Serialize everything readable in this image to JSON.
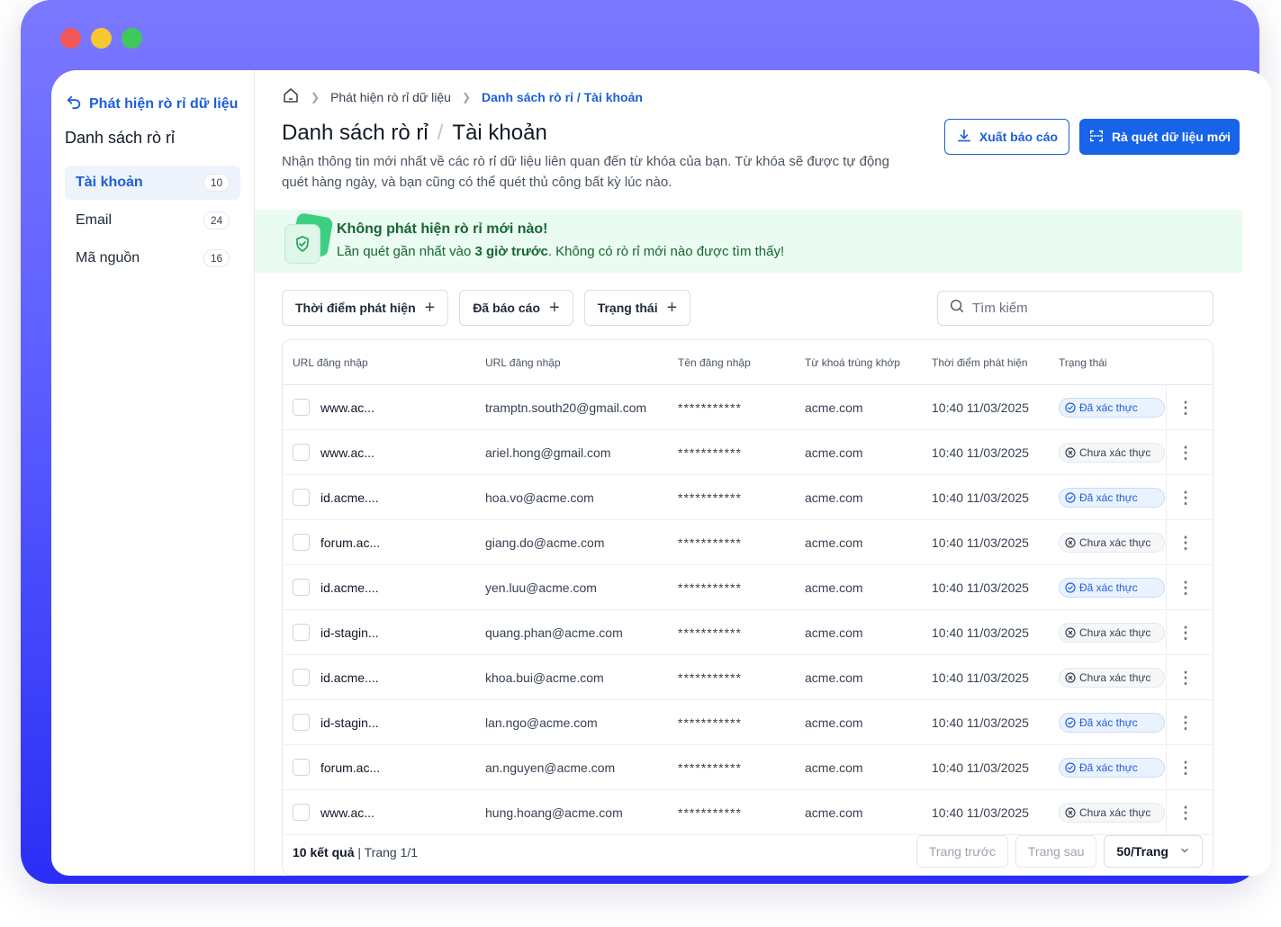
{
  "window_controls": {
    "colors": [
      "#f25757",
      "#f7c72f",
      "#3fc95a"
    ]
  },
  "sidebar": {
    "back_label": "Phát hiện rò rỉ dữ liệu",
    "title": "Danh sách rò rỉ",
    "items": [
      {
        "label": "Tài khoản",
        "count": "10",
        "active": true
      },
      {
        "label": "Email",
        "count": "24",
        "active": false
      },
      {
        "label": "Mã nguồn",
        "count": "16",
        "active": false
      }
    ]
  },
  "breadcrumb": {
    "items": [
      "Phát hiện rò rỉ dữ liệu",
      "Danh sách rò rỉ / Tài khoản"
    ]
  },
  "header": {
    "title_part1": "Danh sách rò rỉ",
    "title_sep": "/",
    "title_part2": "Tài khoản",
    "description": "Nhận thông tin mới nhất về các rò rỉ dữ liệu liên quan đến từ khóa của bạn. Từ khóa sẽ được tự động quét hàng ngày, và bạn cũng có thể quét thủ công bất kỳ lúc nào.",
    "export_label": "Xuất báo cáo",
    "scan_label": "Rà quét dữ liệu mới"
  },
  "alert": {
    "title": "Không phát hiện rò rỉ mới nào!",
    "text_before": "Lần quét gần nhất vào ",
    "text_bold": "3 giờ trước",
    "text_after": ". Không có rò rỉ mới nào được tìm thấy!"
  },
  "filters": [
    "Thời điểm phát hiện",
    "Đã báo cáo",
    "Trạng thái"
  ],
  "search": {
    "placeholder": "Tìm kiếm",
    "value": ""
  },
  "table": {
    "columns": [
      "URL đăng nhập",
      "URL đăng nhập",
      "Tên đăng nhập",
      "Từ khoá trùng khớp",
      "Thời điểm phát hiện",
      "Trạng thái"
    ],
    "rows": [
      {
        "url": "www.ac...",
        "login": "tramptn.south20@gmail.com",
        "username": "***********",
        "keyword": "acme.com",
        "time": "10:40 11/03/2025",
        "status": "Đã xác thực",
        "verified": true
      },
      {
        "url": "www.ac...",
        "login": "ariel.hong@gmail.com",
        "username": "***********",
        "keyword": "acme.com",
        "time": "10:40 11/03/2025",
        "status": "Chưa xác thực",
        "verified": false
      },
      {
        "url": "id.acme....",
        "login": "hoa.vo@acme.com",
        "username": "***********",
        "keyword": "acme.com",
        "time": "10:40 11/03/2025",
        "status": "Đã xác thực",
        "verified": true
      },
      {
        "url": "forum.ac...",
        "login": "giang.do@acme.com",
        "username": "***********",
        "keyword": "acme.com",
        "time": "10:40 11/03/2025",
        "status": "Chưa xác thực",
        "verified": false
      },
      {
        "url": "id.acme....",
        "login": "yen.luu@acme.com",
        "username": "***********",
        "keyword": "acme.com",
        "time": "10:40 11/03/2025",
        "status": "Đã xác thực",
        "verified": true
      },
      {
        "url": "id-stagin...",
        "login": "quang.phan@acme.com",
        "username": "***********",
        "keyword": "acme.com",
        "time": "10:40 11/03/2025",
        "status": "Chưa xác thực",
        "verified": false
      },
      {
        "url": "id.acme....",
        "login": "khoa.bui@acme.com",
        "username": "***********",
        "keyword": "acme.com",
        "time": "10:40 11/03/2025",
        "status": "Chưa xác thực",
        "verified": false
      },
      {
        "url": "id-stagin...",
        "login": "lan.ngo@acme.com",
        "username": "***********",
        "keyword": "acme.com",
        "time": "10:40 11/03/2025",
        "status": "Đã xác thực",
        "verified": true
      },
      {
        "url": "forum.ac...",
        "login": "an.nguyen@acme.com",
        "username": "***********",
        "keyword": "acme.com",
        "time": "10:40 11/03/2025",
        "status": "Đã xác thực",
        "verified": true
      },
      {
        "url": "www.ac...",
        "login": "hung.hoang@acme.com",
        "username": "***********",
        "keyword": "acme.com",
        "time": "10:40 11/03/2025",
        "status": "Chưa xác thực",
        "verified": false
      }
    ]
  },
  "footer": {
    "results_bold": "10 kết quả",
    "page_info": " | Trang 1/1",
    "prev_label": "Trang trước",
    "next_label": "Trang sau",
    "page_size": "50/Trang"
  },
  "colors": {
    "accent": "#1763ea",
    "success": "#166534"
  }
}
